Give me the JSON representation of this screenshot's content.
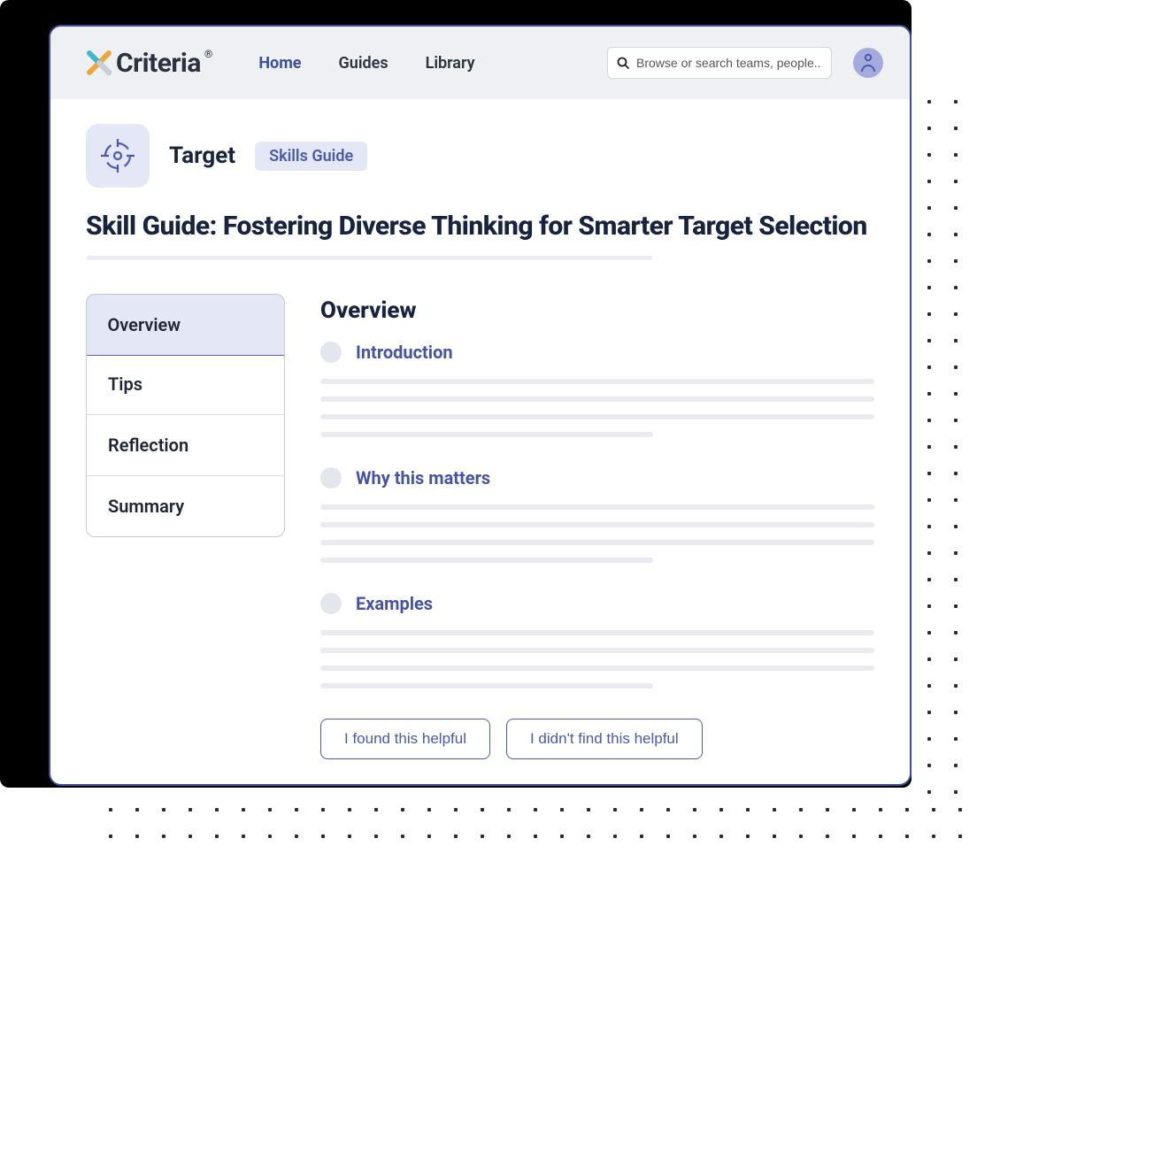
{
  "brand": {
    "name": "Criteria"
  },
  "nav": {
    "items": [
      {
        "label": "Home",
        "active": true
      },
      {
        "label": "Guides",
        "active": false
      },
      {
        "label": "Library",
        "active": false
      }
    ]
  },
  "search": {
    "placeholder": "Browse or search teams, people..."
  },
  "page": {
    "module_label": "Target",
    "badge": "Skills Guide",
    "title": "Skill Guide: Fostering Diverse Thinking for Smarter Target Selection"
  },
  "sidebar": {
    "items": [
      {
        "label": "Overview",
        "active": true
      },
      {
        "label": "Tips",
        "active": false
      },
      {
        "label": "Reflection",
        "active": false
      },
      {
        "label": "Summary",
        "active": false
      }
    ]
  },
  "main": {
    "heading": "Overview",
    "subsections": [
      {
        "title": "Introduction"
      },
      {
        "title": "Why this matters"
      },
      {
        "title": "Examples"
      }
    ]
  },
  "feedback": {
    "helpful": "I found this helpful",
    "not_helpful": "I didn't find this helpful"
  },
  "colors": {
    "accent": "#4a5aad",
    "frame": "#3d4d99",
    "panel": "#e4e7f6"
  }
}
